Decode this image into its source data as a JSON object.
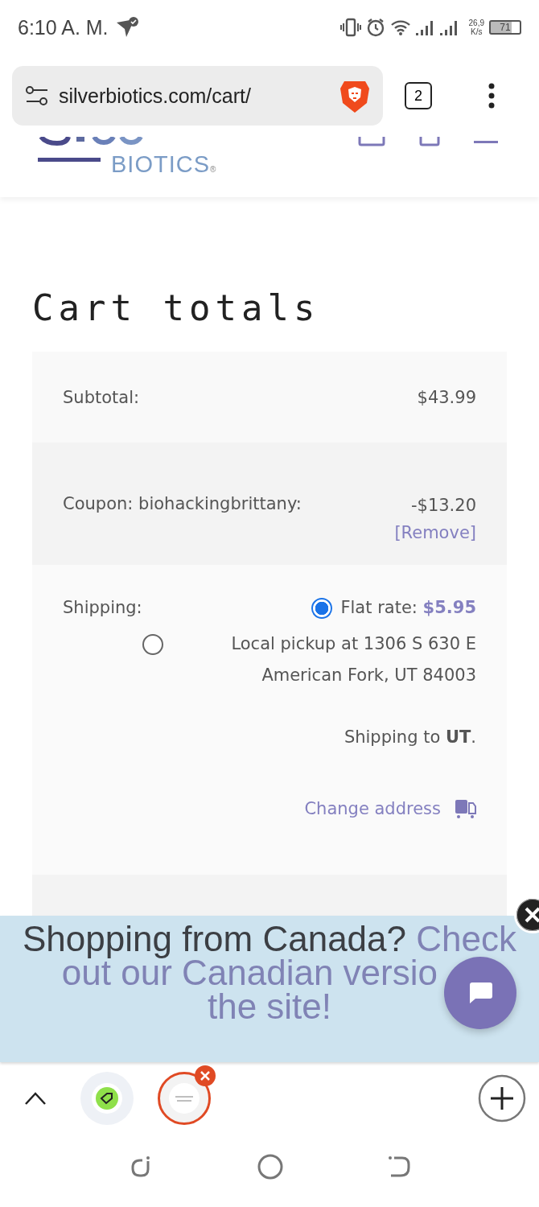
{
  "status_bar": {
    "time": "6:10 A. M.",
    "net_speed": "26,9",
    "net_unit": "K/s",
    "battery": "71"
  },
  "browser": {
    "url": "silverbiotics.com/cart/",
    "tab_count": "2"
  },
  "site_header": {
    "logo_text": "BIOTICS",
    "logo_mark": "®"
  },
  "cart_totals": {
    "title": "Cart totals",
    "rows": [
      {
        "kind": "amount",
        "label": "Subtotal:",
        "value": "$43.99"
      },
      {
        "kind": "coupon",
        "label": "Coupon: biohackingbrittany:",
        "value": "-$13.20",
        "action": "[Remove]"
      },
      {
        "kind": "shipping",
        "label": "Shipping:",
        "options": [
          {
            "label": "Flat rate: ",
            "price": "$5.95",
            "selected": true
          },
          {
            "label": "Local pickup at 1306 S 630 E American Fork, UT 84003",
            "selected": false
          }
        ],
        "destination": "Shipping to **UT**.",
        "action": "Change address"
      },
      {
        "kind": "covered"
      }
    ]
  },
  "banner": {
    "text": "Shopping from Canada?",
    "link_start": "Check",
    "link_lines": [
      "out our Canadian versio",
      "the site!"
    ]
  },
  "tab_strip": {
    "tabs": [
      {
        "kind": "site",
        "selected": false
      },
      {
        "kind": "site",
        "selected": true
      }
    ]
  }
}
